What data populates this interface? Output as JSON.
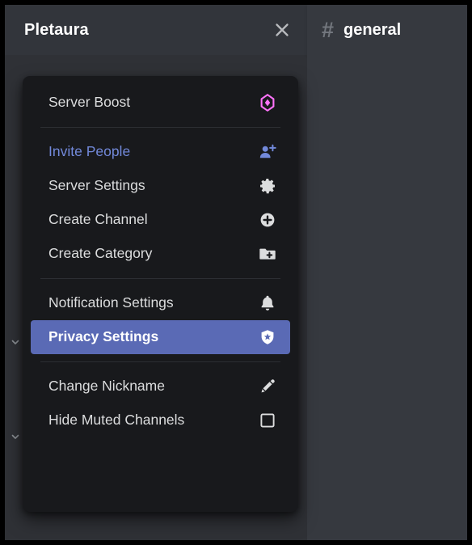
{
  "window": {
    "server_header": {
      "server_name": "Pletaura",
      "close_icon": "close-icon"
    },
    "channel_header": {
      "hash_icon": "#",
      "channel_name": "general"
    },
    "sidebar": {
      "category_collapse_icon": "chevron-down-icon",
      "categories": [
        {
          "collapse_icon": "chevron-down-icon"
        },
        {
          "collapse_icon": "chevron-down-icon"
        }
      ]
    }
  },
  "context_menu": {
    "groups": [
      {
        "items": [
          {
            "label": "Server Boost",
            "icon": "server-boost-icon",
            "tone": "default",
            "selected": false
          }
        ]
      },
      {
        "items": [
          {
            "label": "Invite People",
            "icon": "person-add-icon",
            "tone": "brand",
            "selected": false
          },
          {
            "label": "Server Settings",
            "icon": "gear-icon",
            "tone": "default",
            "selected": false
          },
          {
            "label": "Create Channel",
            "icon": "plus-circle-icon",
            "tone": "default",
            "selected": false
          },
          {
            "label": "Create Category",
            "icon": "folder-plus-icon",
            "tone": "default",
            "selected": false
          }
        ]
      },
      {
        "items": [
          {
            "label": "Notification Settings",
            "icon": "bell-icon",
            "tone": "default",
            "selected": false
          },
          {
            "label": "Privacy Settings",
            "icon": "shield-star-icon",
            "tone": "default",
            "selected": true
          }
        ]
      },
      {
        "items": [
          {
            "label": "Change Nickname",
            "icon": "pencil-icon",
            "tone": "default",
            "selected": false
          },
          {
            "label": "Hide Muted Channels",
            "icon": "checkbox-unchecked-icon",
            "tone": "default",
            "selected": false
          }
        ]
      }
    ]
  },
  "colors": {
    "menu_background": "#18191c",
    "selected_row": "#5a6ab5",
    "header_background": "#32353b",
    "sidebar_background": "#2f3136",
    "chat_background": "#36393f",
    "brand_link": "#7289da",
    "boost_pink": "#ff73fa",
    "text_primary": "#dcddde"
  }
}
